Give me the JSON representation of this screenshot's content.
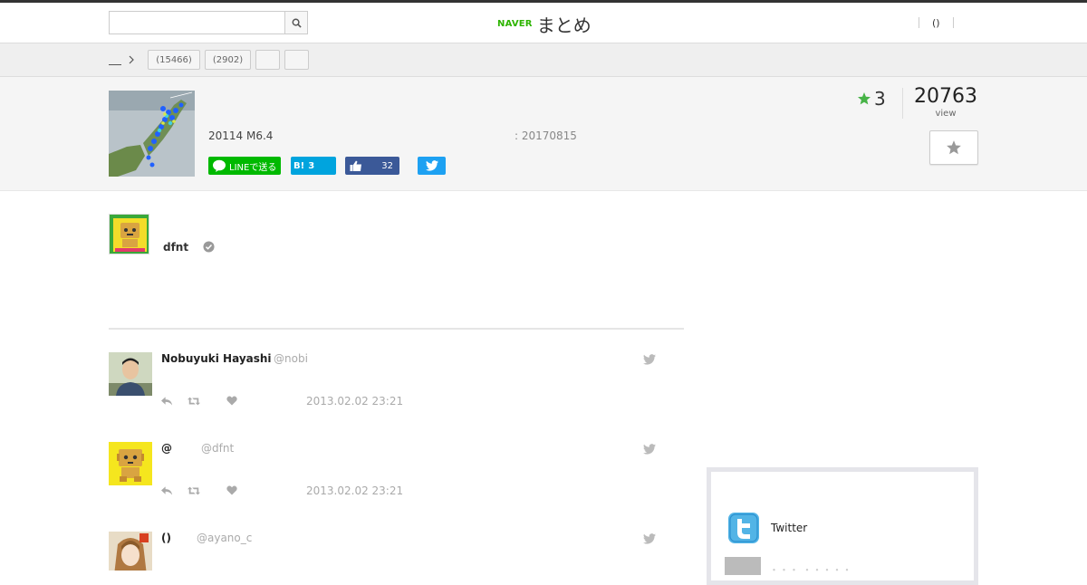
{
  "header": {
    "search_placeholder": "",
    "logo_brand": "NAVER",
    "logo_title": "まとめ",
    "user_menu_label": "()"
  },
  "breadcrumb": {
    "tags": [
      {
        "label": "(15466)"
      },
      {
        "label": "(2902)"
      },
      {
        "label": ""
      },
      {
        "label": ""
      }
    ]
  },
  "summary": {
    "title": "20114 M6.4",
    "date": ": 20170815",
    "favorites_count": "3",
    "views_count": "20763",
    "views_label": "view",
    "share": {
      "line_label": "LINEで送る",
      "hatena_label": "B!",
      "hatena_count": "3",
      "facebook_count": "32"
    }
  },
  "author": {
    "name": "dfnt"
  },
  "tweets": [
    {
      "name": "Nobuyuki Hayashi",
      "handle": "@nobi",
      "time": "2013.02.02 23:21"
    },
    {
      "name": "@",
      "handle": "@dfnt",
      "time": "2013.02.02 23:21"
    },
    {
      "name": "()",
      "handle": "@ayano_c",
      "time": ""
    }
  ],
  "sidebar": {
    "twitter_label": "Twitter",
    "faded_label": "・・・ ・・・・・"
  },
  "colors": {
    "naver_green": "#2db400",
    "line_green": "#00b900",
    "hatena_blue": "#00a4de",
    "facebook_blue": "#3b5998",
    "twitter_blue": "#1da1f2",
    "star_green": "#47b347"
  }
}
